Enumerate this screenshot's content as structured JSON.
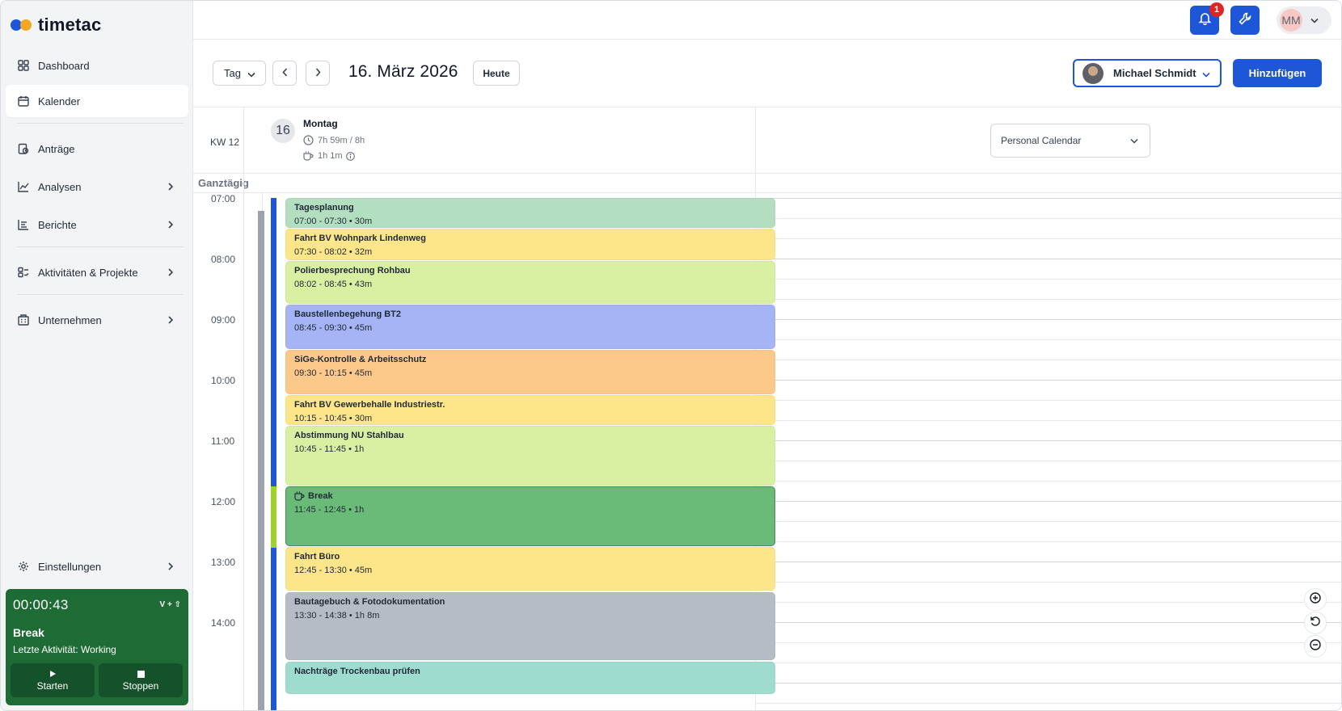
{
  "app": {
    "brand": "timetac"
  },
  "sidebar": {
    "items": [
      {
        "label": "Dashboard",
        "icon": "dashboard-icon"
      },
      {
        "label": "Kalender",
        "icon": "calendar-icon"
      },
      {
        "label": "Anträge",
        "icon": "requests-icon"
      },
      {
        "label": "Analysen",
        "icon": "analytics-icon"
      },
      {
        "label": "Berichte",
        "icon": "reports-icon"
      },
      {
        "label": "Aktivitäten & Projekte",
        "icon": "projects-icon"
      },
      {
        "label": "Unternehmen",
        "icon": "company-icon"
      },
      {
        "label": "Einstellungen",
        "icon": "settings-icon"
      }
    ]
  },
  "timer": {
    "elapsed": "00:00:43",
    "shortcut": "V + ⇧",
    "status": "Break",
    "last_activity": "Letzte Aktivität: Working",
    "start_label": "Starten",
    "stop_label": "Stoppen"
  },
  "topbar": {
    "notification_count": "1",
    "user_initials": "MM"
  },
  "toolbar": {
    "view": "Tag",
    "date": "16. März 2026",
    "today_label": "Heute",
    "selected_user": "Michael Schmidt",
    "add_label": "Hinzufügen"
  },
  "dayhead": {
    "week": "KW 12",
    "day_number": "16",
    "day_name": "Montag",
    "worked": "7h 59m / 8h",
    "break": "1h 1m",
    "calendar_select": "Personal Calendar"
  },
  "allday_label": "Ganztägig",
  "hours": [
    "07:00",
    "08:00",
    "09:00",
    "10:00",
    "11:00",
    "12:00",
    "13:00",
    "14:00"
  ],
  "events": [
    {
      "title": "Tagesplanung",
      "time": "07:00 - 07:30 • 30m",
      "color": "#b3dec0"
    },
    {
      "title": "Fahrt BV Wohnpark Lindenweg",
      "time": "07:30 - 08:02 • 32m",
      "color": "#fde68a"
    },
    {
      "title": "Polierbesprechung Rohbau",
      "time": "08:02 - 08:45 • 43m",
      "color": "#d9f0a3"
    },
    {
      "title": "Baustellenbegehung BT2",
      "time": "08:45 - 09:30 • 45m",
      "color": "#a5b4f5"
    },
    {
      "title": "SiGe-Kontrolle & Arbeitsschutz",
      "time": "09:30 - 10:15 • 45m",
      "color": "#fdc98a"
    },
    {
      "title": "Fahrt BV Gewerbehalle Industriestr.",
      "time": "10:15 - 10:45 • 30m",
      "color": "#fde68a"
    },
    {
      "title": "Abstimmung NU Stahlbau",
      "time": "10:45 - 11:45 • 1h",
      "color": "#d9f0a3"
    },
    {
      "title": "Break",
      "time": "11:45 - 12:45 • 1h",
      "color": "#6bbb78"
    },
    {
      "title": "Fahrt Büro",
      "time": "12:45 - 13:30 • 45m",
      "color": "#fde68a"
    },
    {
      "title": "Bautagebuch & Fotodokumentation",
      "time": "13:30 - 14:38 • 1h 8m",
      "color": "#b6bcc5"
    },
    {
      "title": "Nachträge Trockenbau prüfen",
      "time": "",
      "color": "#9fdcd0"
    }
  ],
  "colors": {
    "accent": "#1d56d6",
    "timer_bg": "#1f6b35",
    "badge": "#e02424",
    "activity_bar_blue": "#1d56d6",
    "activity_bar_lime": "#9ed32a",
    "activity_bar_gray": "#9ca3af"
  }
}
